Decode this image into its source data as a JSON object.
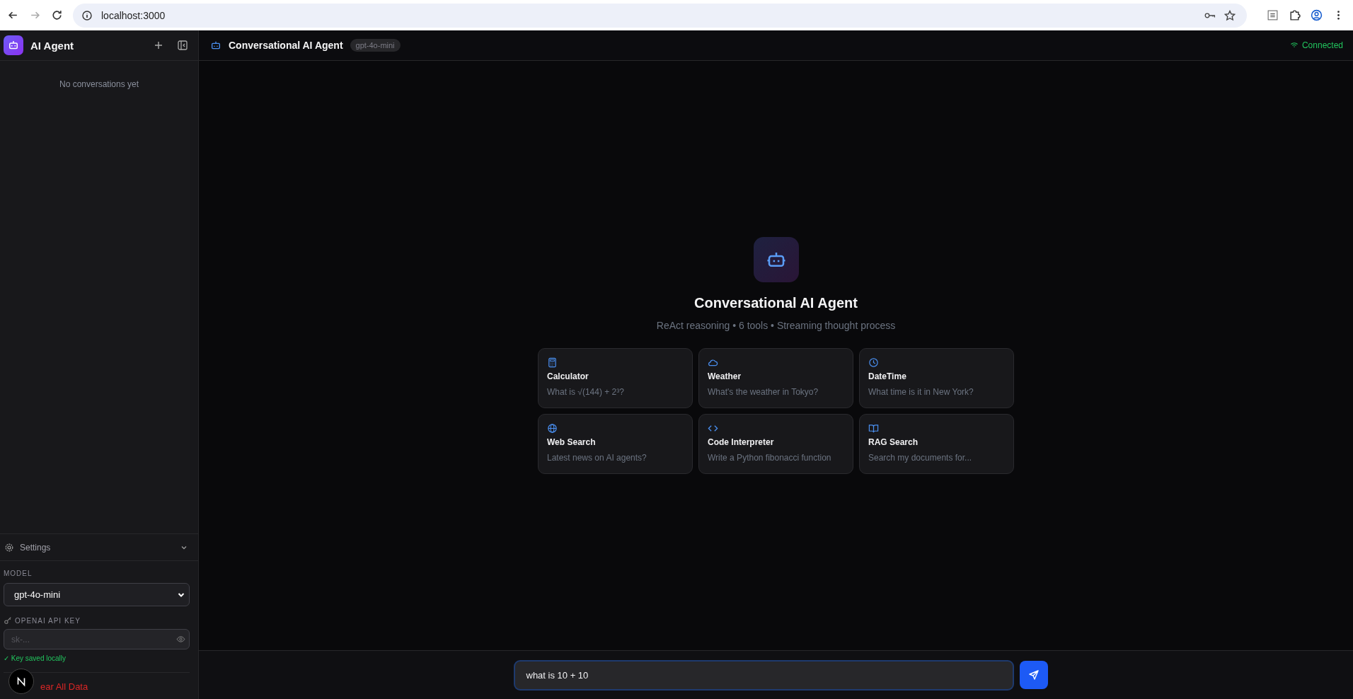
{
  "browser": {
    "url": "localhost:3000"
  },
  "sidebar": {
    "app_name": "AI Agent",
    "empty_text": "No conversations yet",
    "settings": {
      "label": "Settings",
      "expanded": true,
      "model_label": "MODEL",
      "model_value": "gpt-4o-mini",
      "api_key_label": "OPENAI API KEY",
      "api_key_placeholder": "sk-...",
      "key_status": "✓ Key saved locally",
      "clear_label": "ear All Data"
    }
  },
  "header": {
    "title": "Conversational AI Agent",
    "model_badge": "gpt-4o-mini",
    "status": "Connected",
    "connected": true
  },
  "welcome": {
    "title": "Conversational AI Agent",
    "subtitle": "ReAct reasoning • 6 tools • Streaming thought process"
  },
  "tools": [
    {
      "kind": "calculator",
      "name": "Calculator",
      "example": "What is √(144) + 2³?"
    },
    {
      "kind": "weather",
      "name": "Weather",
      "example": "What's the weather in Tokyo?"
    },
    {
      "kind": "datetime",
      "name": "DateTime",
      "example": "What time is it in New York?"
    },
    {
      "kind": "web",
      "name": "Web Search",
      "example": "Latest news on AI agents?"
    },
    {
      "kind": "code",
      "name": "Code Interpreter",
      "example": "Write a Python fibonacci function"
    },
    {
      "kind": "rag",
      "name": "RAG Search",
      "example": "Search my documents for..."
    }
  ],
  "composer": {
    "value": "what is 10 + 10"
  }
}
